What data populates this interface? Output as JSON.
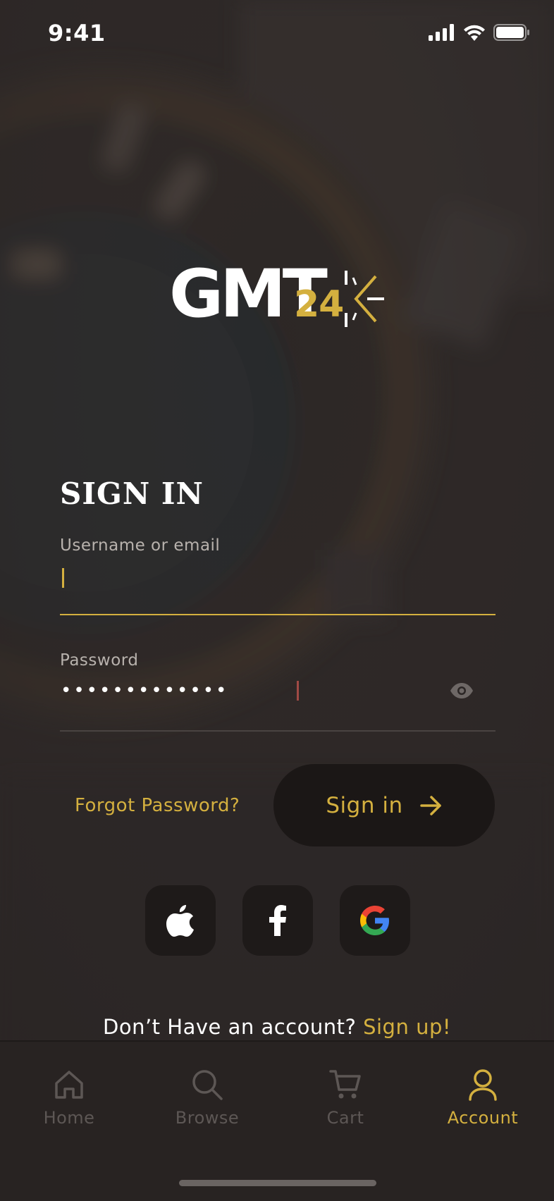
{
  "status_bar": {
    "time": "9:41",
    "icons": [
      "cellular-signal-icon",
      "wifi-icon",
      "battery-icon"
    ]
  },
  "logo": {
    "main": "GMT",
    "number": "24"
  },
  "signin": {
    "title": "SIGN IN",
    "username_label": "Username or email",
    "username_value": "",
    "password_label": "Password",
    "password_value": "•••••••••••••",
    "forgot_label": "Forgot Password?",
    "button_label": "Sign in"
  },
  "social": [
    "apple-icon",
    "facebook-icon",
    "google-icon"
  ],
  "signup": {
    "text": "Don’t Have an account?",
    "link": "Sign up!"
  },
  "tabbar": {
    "items": [
      {
        "label": "Home",
        "icon": "home-icon",
        "active": false
      },
      {
        "label": "Browse",
        "icon": "search-icon",
        "active": false
      },
      {
        "label": "Cart",
        "icon": "cart-icon",
        "active": false
      },
      {
        "label": "Account",
        "icon": "user-icon",
        "active": true
      }
    ]
  },
  "colors": {
    "accent": "#d4b03f",
    "background": "#2b2625",
    "button_bg": "#1b1716",
    "inactive": "#5d5755"
  }
}
